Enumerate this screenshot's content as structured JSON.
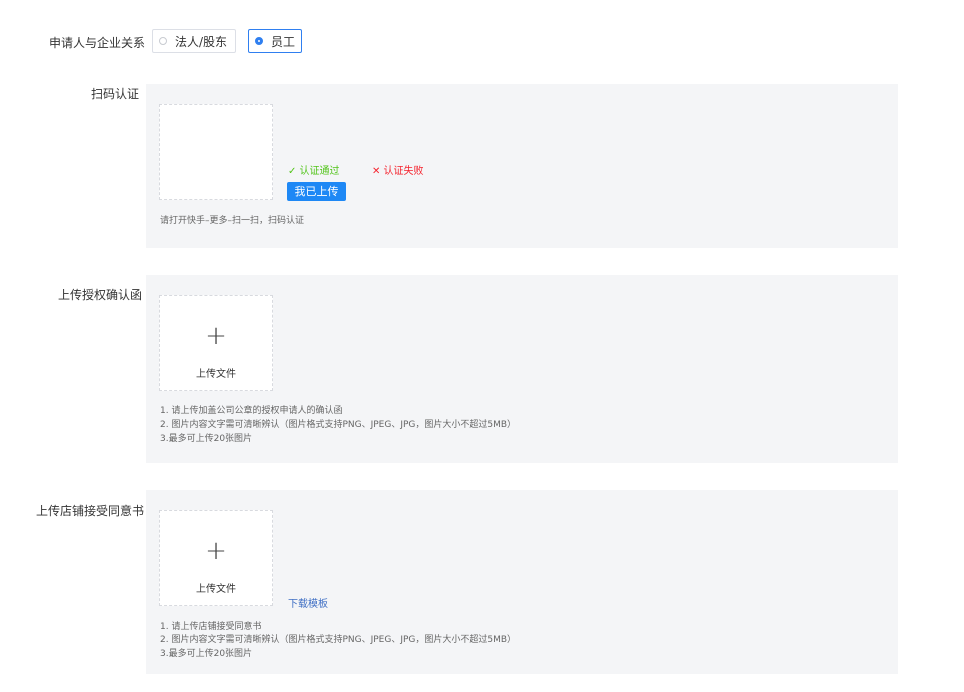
{
  "relation": {
    "label": "申请人与企业关系",
    "options": [
      {
        "label": "法人/股东",
        "selected": false
      },
      {
        "label": "员工",
        "selected": true
      }
    ]
  },
  "scan": {
    "label": "扫码认证",
    "status_ok": "✓ 认证通过",
    "status_fail": "✕ 认证失败",
    "button": "我已上传",
    "hint": "请打开快手–更多–扫一扫，扫码认证"
  },
  "auth_letter": {
    "label": "上传授权确认函",
    "upload_text": "上传文件",
    "notes": [
      "1. 请上传加盖公司公章的授权申请人的确认函",
      "2. 图片内容文字需可清晰辨认（图片格式支持PNG、JPEG、JPG，图片大小不超过5MB）",
      "3.最多可上传20张图片"
    ]
  },
  "shop_agreement": {
    "label": "上传店铺接受同意书",
    "upload_text": "上传文件",
    "download": "下载模板",
    "notes": [
      "1. 请上传店铺接受同意书",
      "2. 图片内容文字需可清晰辨认（图片格式支持PNG、JPEG、JPG，图片大小不超过5MB）",
      "3.最多可上传20张图片"
    ]
  },
  "colors": {
    "primary": "#1e88f5",
    "success": "#52c41a",
    "danger": "#f5222d",
    "panel_bg": "#f4f5f7"
  },
  "icons": {
    "plus": "+"
  }
}
